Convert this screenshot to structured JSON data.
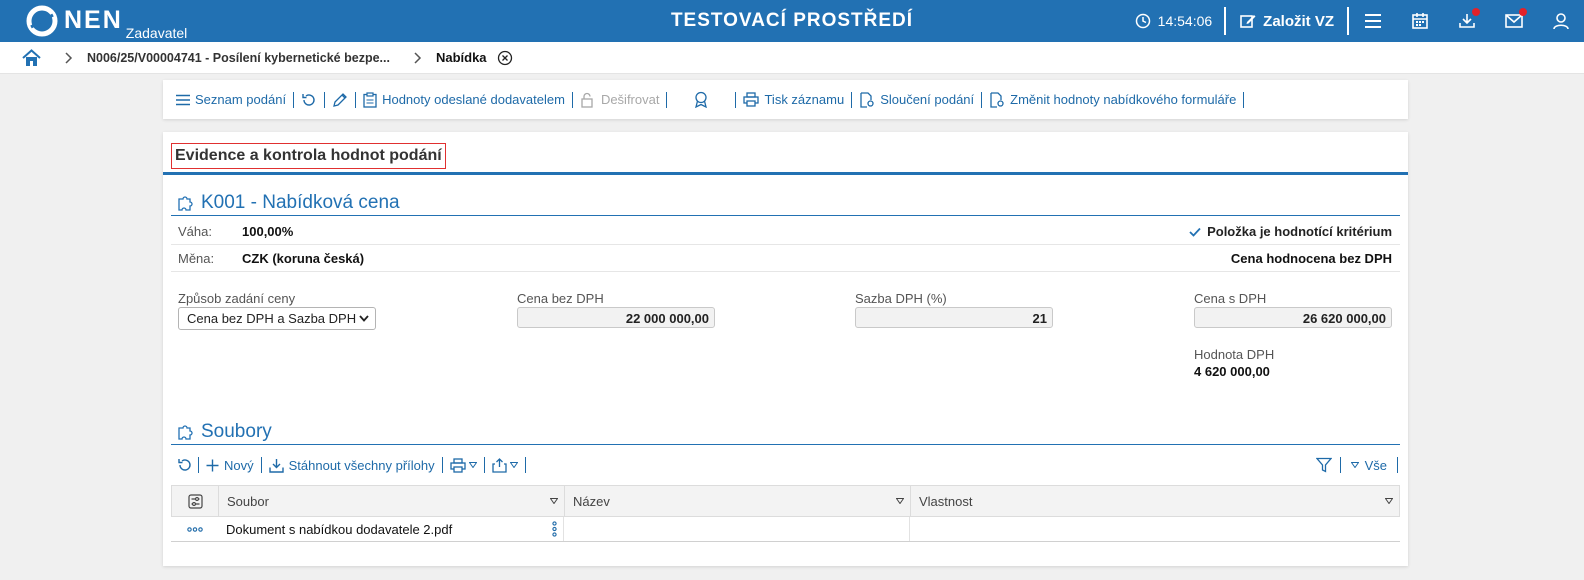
{
  "topbar": {
    "logo_text": "NEN",
    "logo_sub": "Zadavatel",
    "title": "TESTOVACÍ PROSTŘEDÍ",
    "time": "14:54:06",
    "create_label": "Založit VZ",
    "accent": "#2271b3"
  },
  "breadcrumb": {
    "item1": "N006/25/V00004741 - Posílení kybernetické bezpe...",
    "item2": "Nabídka"
  },
  "toolbar": {
    "list": "Seznam podání",
    "sent_values": "Hodnoty odeslané dodavatelem",
    "decrypt": "Dešifrovat",
    "print": "Tisk záznamu",
    "merge": "Sloučení podání",
    "change": "Změnit hodnoty nabídkového formuláře"
  },
  "page": {
    "heading": "Evidence a kontrola hodnot podání"
  },
  "criterion": {
    "title": "K001 - Nabídková cena",
    "weight_label": "Váha:",
    "weight": "100,00%",
    "currency_label": "Měna:",
    "currency": "CZK (koruna česká)",
    "is_criterion": "Položka je hodnotící kritérium",
    "price_eval": "Cena hodnocena bez DPH",
    "method_label": "Způsob zadání ceny",
    "method_value": "Cena bez DPH a Sazba DPH",
    "price_no_vat_label": "Cena bez DPH",
    "price_no_vat": "22 000 000,00",
    "vat_rate_label": "Sazba DPH (%)",
    "vat_rate": "21",
    "price_vat_label": "Cena s DPH",
    "price_vat": "26 620 000,00",
    "vat_value_label": "Hodnota DPH",
    "vat_value": "4 620 000,00"
  },
  "files": {
    "title": "Soubory",
    "new": "Nový",
    "download_all": "Stáhnout všechny přílohy",
    "filter_all": "Vše",
    "columns": [
      "Soubor",
      "Název",
      "Vlastnost"
    ],
    "rows": [
      {
        "file": "Dokument s nabídkou dodavatele 2.pdf",
        "name": "",
        "property": ""
      }
    ]
  }
}
